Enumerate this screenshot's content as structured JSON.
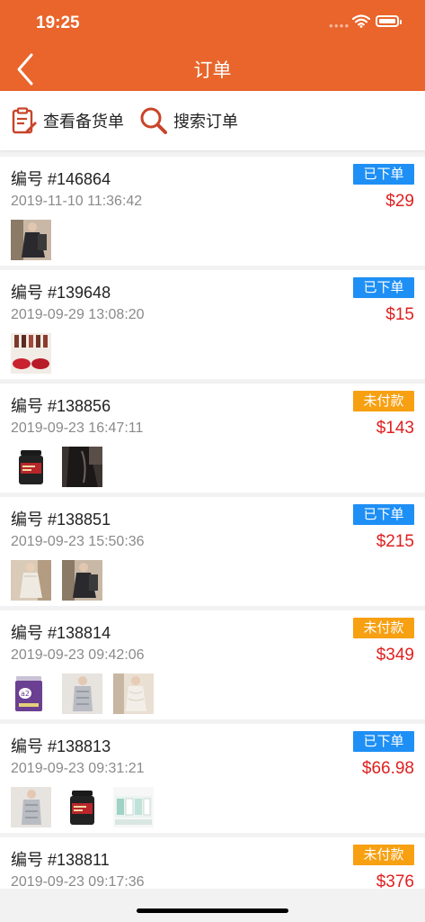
{
  "status": {
    "time": "19:25"
  },
  "nav": {
    "title": "订单"
  },
  "toolbar": {
    "stock_label": "查看备货单",
    "search_label": "搜索订单"
  },
  "colors": {
    "header": "#e9652b",
    "badge_ordered": "#1e8ff5",
    "badge_unpaid": "#f7a012",
    "price": "#e02020"
  },
  "orders": [
    {
      "no": "编号 #146864",
      "time": "2019-11-10 11:36:42",
      "status": "已下单",
      "status_type": "ordered",
      "price": "$29",
      "thumbs": [
        "dress-photo-dark"
      ]
    },
    {
      "no": "编号 #139648",
      "time": "2019-09-29 13:08:20",
      "status": "已下单",
      "status_type": "ordered",
      "price": "$15",
      "thumbs": [
        "lipstick-photo"
      ]
    },
    {
      "no": "编号 #138856",
      "time": "2019-09-23 16:47:11",
      "status": "未付款",
      "status_type": "unpaid",
      "price": "$143",
      "thumbs": [
        "supplement-jar-photo",
        "dark-garment-photo"
      ]
    },
    {
      "no": "编号 #138851",
      "time": "2019-09-23 15:50:36",
      "status": "已下单",
      "status_type": "ordered",
      "price": "$215",
      "thumbs": [
        "dress-photo-light",
        "dress-photo-dark"
      ]
    },
    {
      "no": "编号 #138814",
      "time": "2019-09-23 09:42:06",
      "status": "未付款",
      "status_type": "unpaid",
      "price": "$349",
      "thumbs": [
        "milk-formula-can-photo",
        "silver-outfit-photo",
        "lace-dress-photo"
      ]
    },
    {
      "no": "编号 #138813",
      "time": "2019-09-23 09:31:21",
      "status": "已下单",
      "status_type": "ordered",
      "price": "$66.98",
      "thumbs": [
        "silver-outfit-photo",
        "supplement-jar-photo",
        "skincare-box-photo"
      ]
    },
    {
      "no": "编号 #138811",
      "time": "2019-09-23 09:17:36",
      "status": "未付款",
      "status_type": "unpaid",
      "price": "$376",
      "thumbs": []
    }
  ]
}
